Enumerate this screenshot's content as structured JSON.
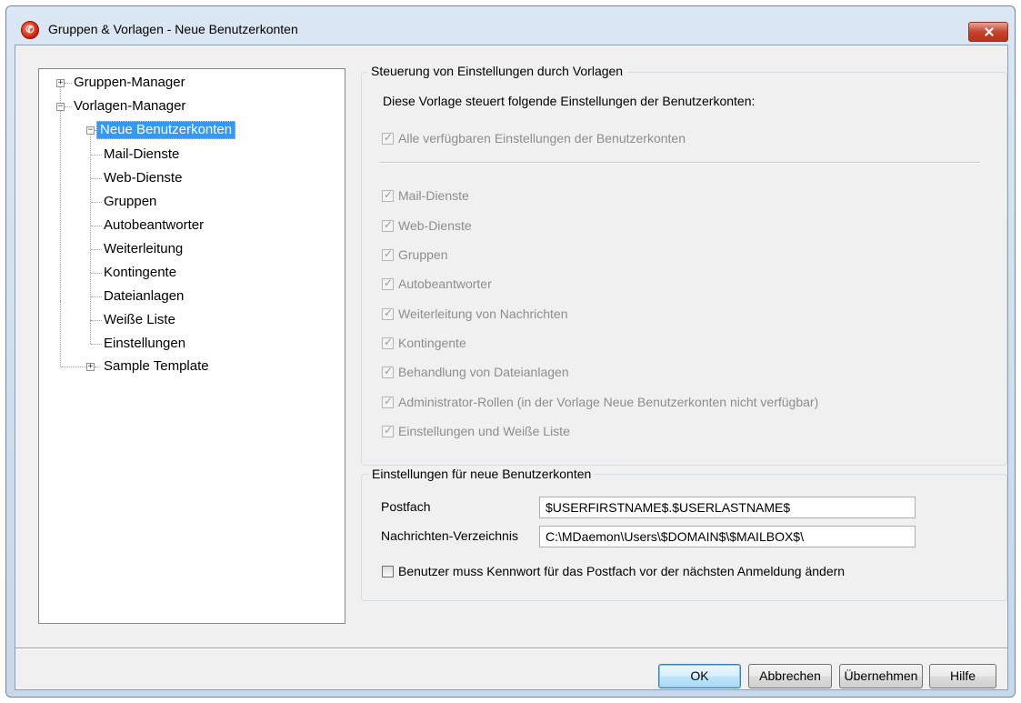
{
  "window": {
    "title": "Gruppen & Vorlagen - Neue Benutzerkonten"
  },
  "tree": {
    "items": [
      {
        "label": "Gruppen-Manager"
      },
      {
        "label": "Vorlagen-Manager"
      },
      {
        "label": "Neue Benutzerkonten"
      },
      {
        "label": "Mail-Dienste"
      },
      {
        "label": "Web-Dienste"
      },
      {
        "label": "Gruppen"
      },
      {
        "label": "Autobeantworter"
      },
      {
        "label": "Weiterleitung"
      },
      {
        "label": "Kontingente"
      },
      {
        "label": "Dateianlagen"
      },
      {
        "label": "Weiße Liste"
      },
      {
        "label": "Einstellungen"
      },
      {
        "label": "Sample Template"
      }
    ]
  },
  "control": {
    "title": "Steuerung von Einstellungen durch Vorlagen",
    "description": "Diese Vorlage steuert folgende Einstellungen der Benutzerkonten:",
    "all_label": "Alle verfügbaren Einstellungen der Benutzerkonten",
    "options": [
      {
        "label": "Mail-Dienste"
      },
      {
        "label": "Web-Dienste"
      },
      {
        "label": "Gruppen"
      },
      {
        "label": "Autobeantworter"
      },
      {
        "label": "Weiterleitung von Nachrichten"
      },
      {
        "label": "Kontingente"
      },
      {
        "label": "Behandlung von Dateianlagen"
      },
      {
        "label": "Administrator-Rollen (in der Vorlage Neue Benutzerkonten nicht verfügbar)"
      },
      {
        "label": "Einstellungen und Weiße Liste"
      }
    ]
  },
  "newaccounts": {
    "title": "Einstellungen für neue Benutzerkonten",
    "mailbox_label": "Postfach",
    "mailbox_value": "$USERFIRSTNAME$.$USERLASTNAME$",
    "dir_label": "Nachrichten-Verzeichnis",
    "dir_value": "C:\\MDaemon\\Users\\$DOMAIN$\\$MAILBOX$\\",
    "password_label": "Benutzer muss Kennwort für das Postfach vor der nächsten Anmeldung ändern"
  },
  "buttons": {
    "ok": "OK",
    "cancel": "Abbrechen",
    "apply": "Übernehmen",
    "help": "Hilfe"
  }
}
